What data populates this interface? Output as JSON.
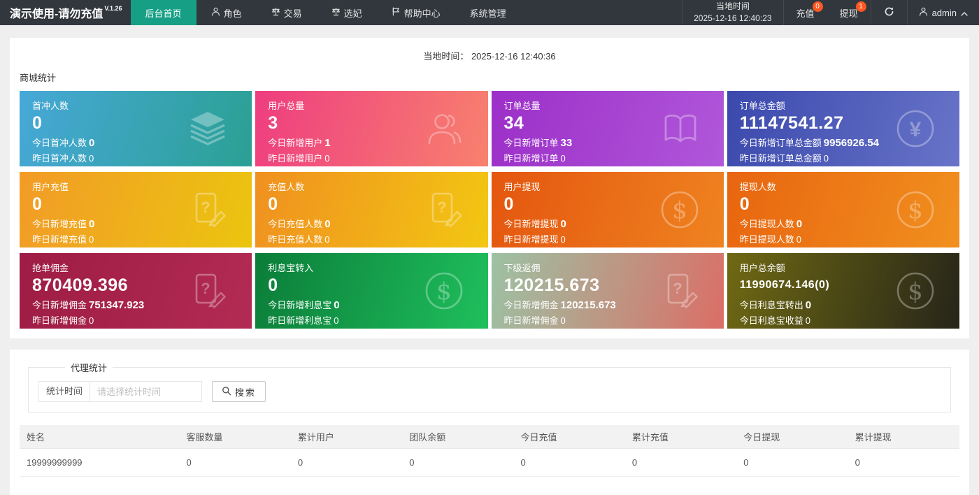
{
  "navbar": {
    "brand": "演示使用-请勿充值",
    "version": "V.1.26",
    "menu": [
      {
        "label": "后台首页",
        "icon": null,
        "active": true
      },
      {
        "label": "角色",
        "icon": "user"
      },
      {
        "label": "交易",
        "icon": "scales"
      },
      {
        "label": "选妃",
        "icon": "scales"
      },
      {
        "label": "帮助中心",
        "icon": "flag"
      },
      {
        "label": "系统管理",
        "icon": null
      }
    ],
    "local_time_label": "当地时间",
    "local_time_value": "2025-12-16 12:40:23",
    "recharge": {
      "label": "充值",
      "badge": "0"
    },
    "withdraw": {
      "label": "提现",
      "badge": "1"
    },
    "username": "admin"
  },
  "main": {
    "time_label": "当地时间：",
    "time_value": "2025-12-16 12:40:36",
    "stats_title": "商城统计",
    "cards": [
      {
        "title": "首冲人数",
        "value": "0",
        "line2_label": "今日首冲人数",
        "line2_value": "0",
        "line3_label": "昨日首冲人数",
        "line3_value": "0",
        "icon": "layers-icon",
        "g1": "#47a8d8",
        "g2": "#2ba093"
      },
      {
        "title": "用户总量",
        "value": "3",
        "line2_label": "今日新增用户",
        "line2_value": "1",
        "line3_label": "昨日新增用户",
        "line3_value": "0",
        "icon": "users-icon",
        "g1": "#ee3d80",
        "g2": "#f8816e"
      },
      {
        "title": "订单总量",
        "value": "34",
        "line2_label": "今日新增订单",
        "line2_value": "33",
        "line3_label": "昨日新增订单",
        "line3_value": "0",
        "icon": "book-icon",
        "g1": "#9c2fc8",
        "g2": "#b057da"
      },
      {
        "title": "订单总金额",
        "value": "11147541.27",
        "line2_label": "今日新增订单总金额",
        "line2_value": "9956926.54",
        "line3_label": "昨日新增订单总金额",
        "line3_value": "0",
        "icon": "yen-circle-icon",
        "g1": "#3b49ad",
        "g2": "#6874c8"
      },
      {
        "title": "用户充值",
        "value": "0",
        "line2_label": "今日新增充值",
        "line2_value": "0",
        "line3_label": "昨日新增充值",
        "line3_value": "0",
        "icon": "doc-question-icon",
        "g1": "#f29b27",
        "g2": "#ebc50f"
      },
      {
        "title": "充值人数",
        "value": "0",
        "line2_label": "今日充值人数",
        "line2_value": "0",
        "line3_label": "昨日充值人数",
        "line3_value": "0",
        "icon": "doc-question-icon",
        "g1": "#f09020",
        "g2": "#f2c712"
      },
      {
        "title": "用户提现",
        "value": "0",
        "line2_label": "今日新增提现",
        "line2_value": "0",
        "line3_label": "昨日新增提现",
        "line3_value": "0",
        "icon": "dollar-circle-icon",
        "g1": "#e4560f",
        "g2": "#ef8320"
      },
      {
        "title": "提现人数",
        "value": "0",
        "line2_label": "今日提现人数",
        "line2_value": "0",
        "line3_label": "昨日提现人数",
        "line3_value": "0",
        "icon": "dollar-circle-icon",
        "g1": "#e8650f",
        "g2": "#f1901f"
      },
      {
        "title": "抢单佣金",
        "value": "870409.396",
        "line2_label": "今日新增佣金",
        "line2_value": "751347.923",
        "line3_label": "昨日新增佣金",
        "line3_value": "0",
        "icon": "doc-question-icon",
        "g1": "#9e1c45",
        "g2": "#b22b54"
      },
      {
        "title": "利息宝转入",
        "value": "0",
        "line2_label": "今日新增利息宝",
        "line2_value": "0",
        "line3_label": "昨日新增利息宝",
        "line3_value": "0",
        "icon": "dollar-circle-icon",
        "g1": "#0b7d39",
        "g2": "#1fbf5d"
      },
      {
        "title": "下级返佣",
        "value": "120215.673",
        "line2_label": "今日新增佣金",
        "line2_value": "120215.673",
        "line3_label": "昨日新增佣金",
        "line3_value": "0",
        "icon": "doc-question-icon",
        "g1": "#9cc2a4",
        "g2": "#db6e66"
      },
      {
        "title": "用户总余额",
        "value": "11990674.146(0)",
        "line2_label": "今日利息宝转出",
        "line2_value": "0",
        "line3_label": "今日利息宝收益",
        "line3_value": "0",
        "icon": "dollar-circle-icon",
        "g1": "#6f6913",
        "g2": "#262519",
        "small_value": true
      }
    ]
  },
  "agent": {
    "legend": "代理统计",
    "filter_label": "统计时间",
    "filter_placeholder": "请选择统计时间",
    "search_label": "搜索",
    "table": {
      "headers": [
        "姓名",
        "客服数量",
        "累计用户",
        "团队余额",
        "今日充值",
        "累计充值",
        "今日提现",
        "累计提现"
      ],
      "rows": [
        [
          "19999999999",
          "0",
          "0",
          "0",
          "0",
          "0",
          "0",
          "0"
        ]
      ]
    }
  },
  "colors": {
    "navbar_bg": "#32373d",
    "active_tab": "#169f85",
    "badge": "#ff5722",
    "page_bg": "#efefef"
  }
}
